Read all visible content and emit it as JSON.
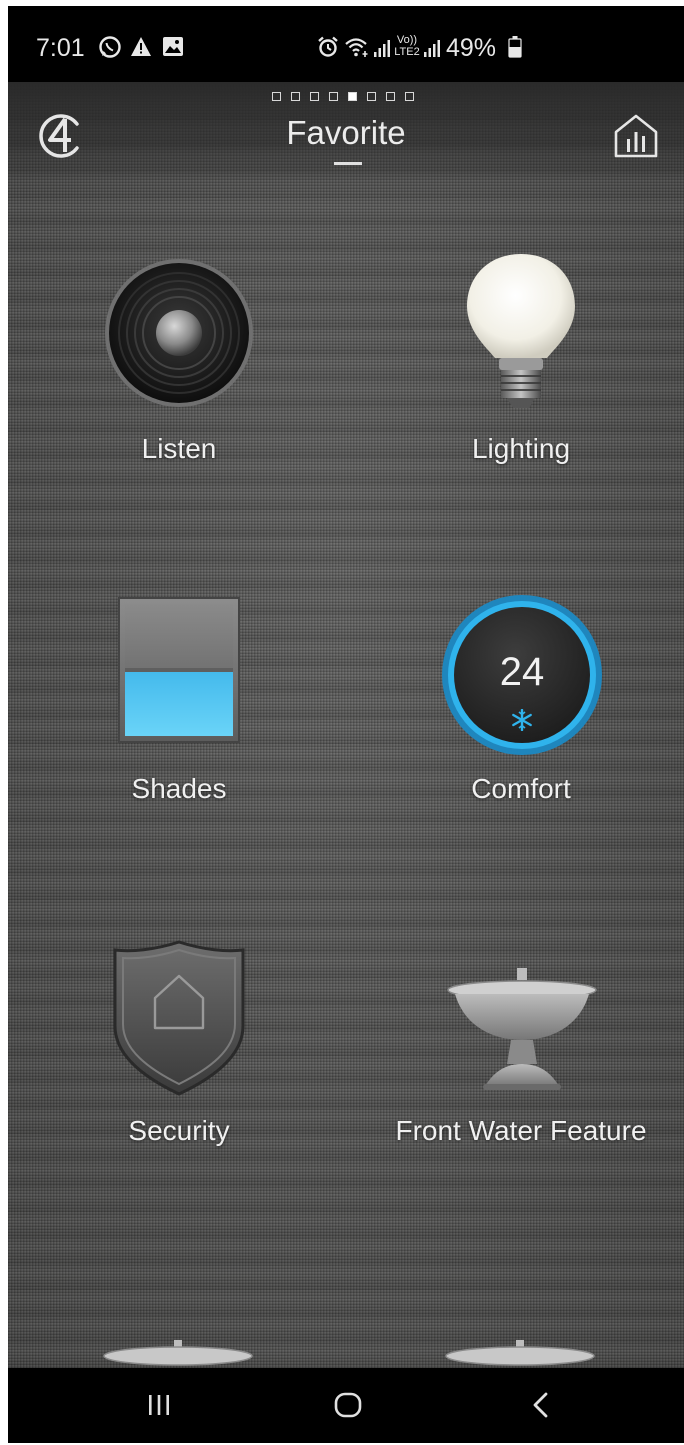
{
  "status_bar": {
    "time": "7:01",
    "battery_percent": "49%",
    "icons": [
      "whatsapp-icon",
      "alert-icon",
      "gallery-icon",
      "alarm-icon",
      "wifi-icon",
      "signal-icon",
      "volte-icon",
      "signal-icon",
      "battery-icon"
    ],
    "volte_label_top": "Vo))",
    "volte_label_bottom": "LTE2"
  },
  "header": {
    "title": "Favorite",
    "left_icon": "control4-logo-icon",
    "right_icon": "house-stats-icon",
    "page_count": 8,
    "active_page_index": 4
  },
  "tiles": [
    {
      "label": "Listen",
      "icon": "speaker-icon"
    },
    {
      "label": "Lighting",
      "icon": "light-bulb-icon"
    },
    {
      "label": "Shades",
      "icon": "shade-icon",
      "shade_level_percent": 50
    },
    {
      "label": "Comfort",
      "icon": "thermostat-icon",
      "temperature": "24",
      "mode_icon": "snowflake-icon"
    },
    {
      "label": "Security",
      "icon": "shield-house-icon"
    },
    {
      "label": "Front Water Feature",
      "icon": "fountain-icon"
    }
  ],
  "nav_bar": {
    "buttons": [
      "recent-apps-icon",
      "home-icon",
      "back-icon"
    ]
  },
  "colors": {
    "accent_blue": "#29a9e6",
    "background_fabric": "#5d5d5c",
    "text": "#f0f0f0"
  }
}
